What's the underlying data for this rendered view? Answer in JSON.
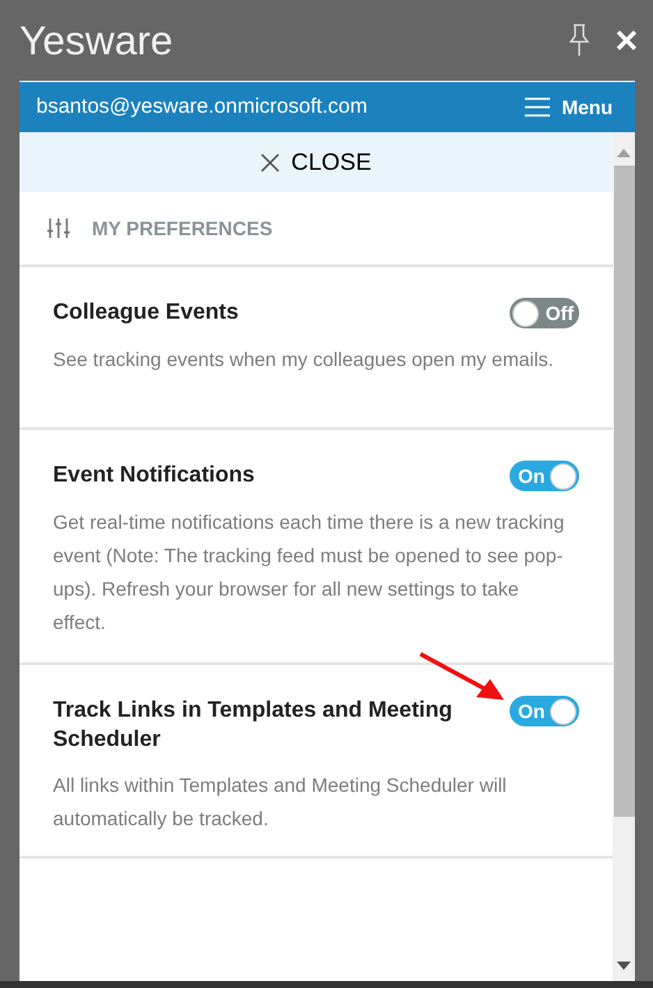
{
  "window": {
    "title": "Yesware"
  },
  "account": {
    "email": "bsantos@yesware.onmicrosoft.com",
    "menu_label": "Menu"
  },
  "close_bar": {
    "label": "CLOSE"
  },
  "section_header": {
    "label": "MY PREFERENCES"
  },
  "preferences": [
    {
      "title": "Colleague Events",
      "description": "See tracking events when my colleagues open my emails.",
      "on": false,
      "toggle_label": "Off"
    },
    {
      "title": "Event Notifications",
      "description": "Get real-time notifications each time there is a new tracking event (Note: The tracking feed must be opened to see pop-ups). Refresh your browser for all new settings to take effect.",
      "on": true,
      "toggle_label": "On"
    },
    {
      "title": "Track Links in Templates and Meeting Scheduler",
      "description": "All links within Templates and Meeting Scheduler will automatically be tracked.",
      "on": true,
      "toggle_label": "On",
      "annotated": true
    }
  ]
}
